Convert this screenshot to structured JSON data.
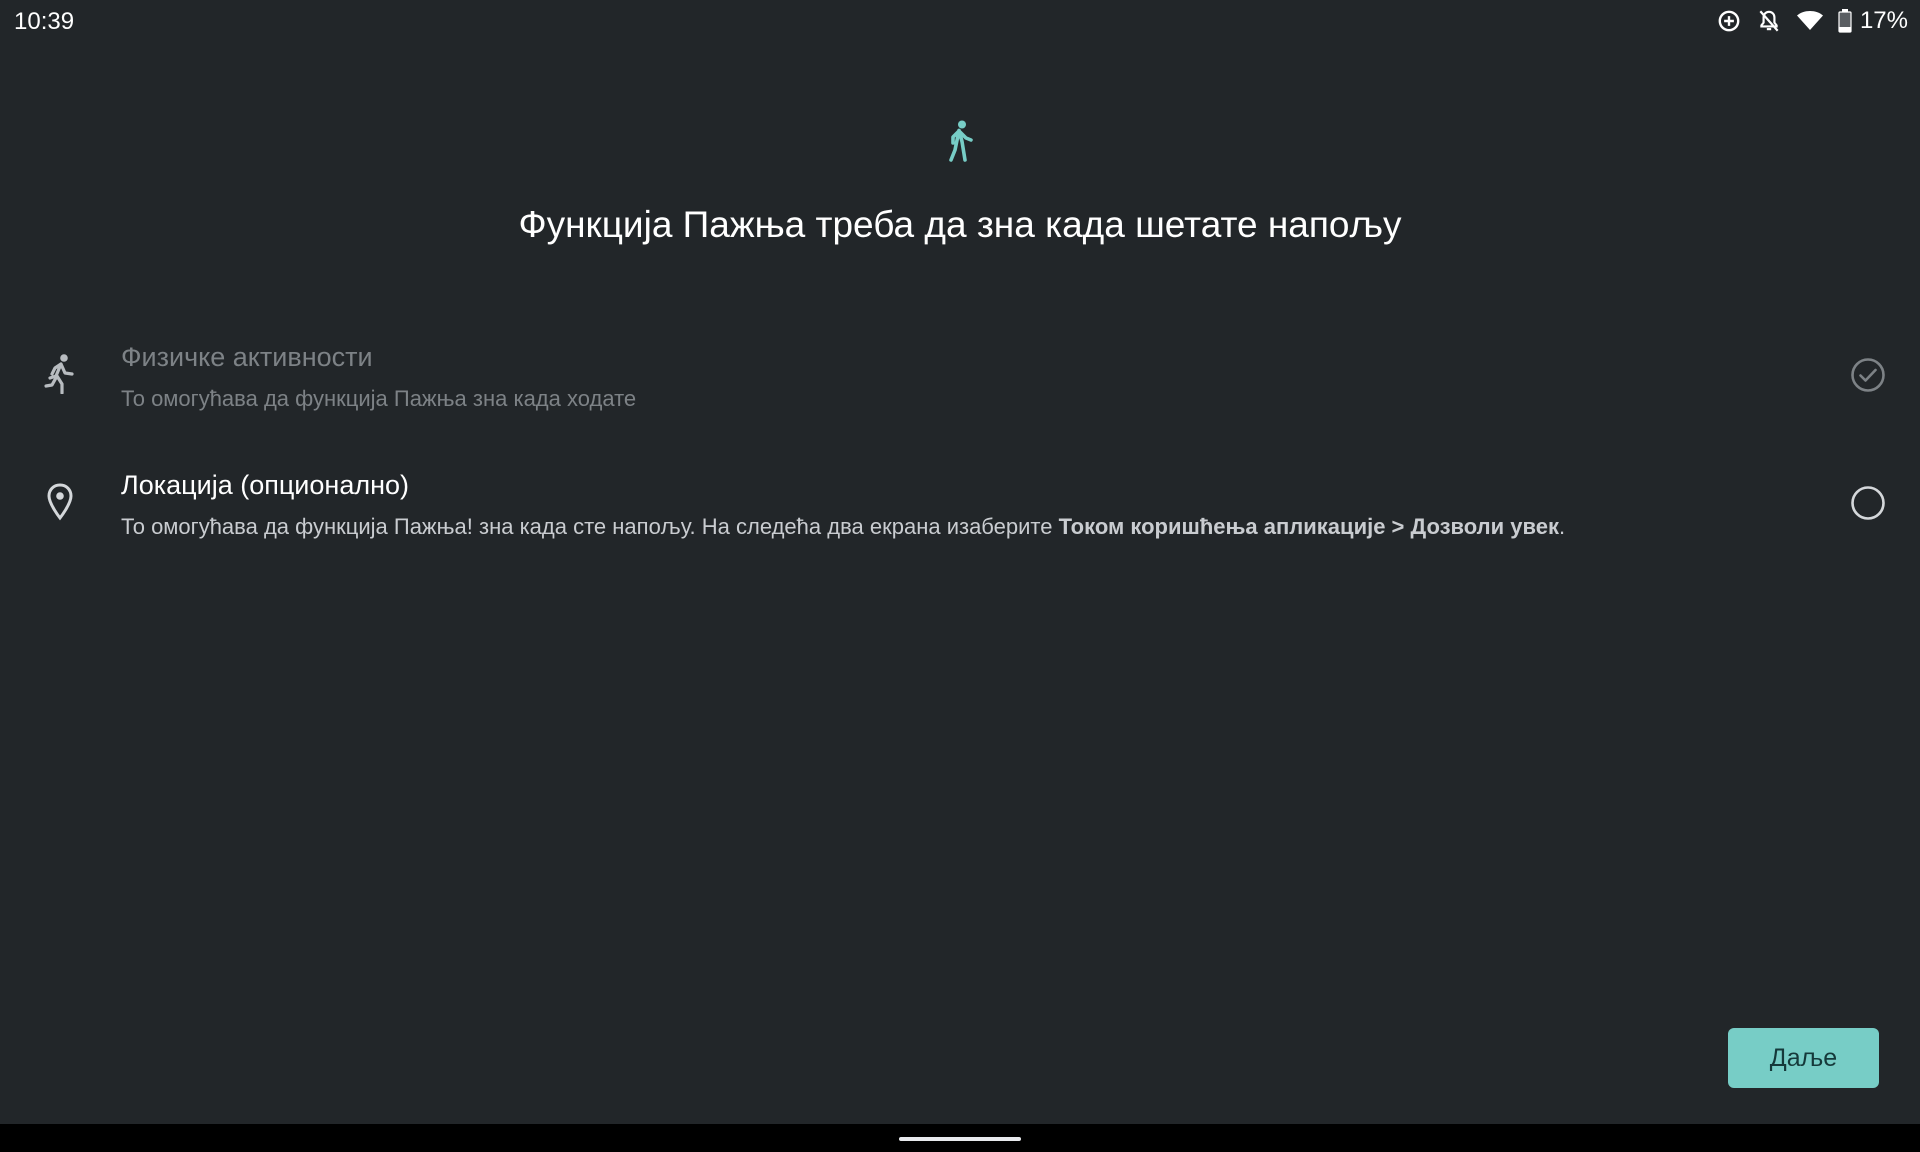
{
  "status_bar": {
    "time": "10:39",
    "battery_percent": "17%",
    "icons": [
      "data-saver-icon",
      "notifications-off-icon",
      "wifi-icon",
      "battery-icon"
    ]
  },
  "header": {
    "icon": "walking-person-icon",
    "title": "Функција Пажња треба да зна када шетате напољу"
  },
  "permissions": [
    {
      "icon": "running-person-icon",
      "title": "Физичке активности",
      "description": "То омогућава да функција Пажња зна када ходате",
      "granted": true,
      "status_icon": "check-circle-icon"
    },
    {
      "icon": "location-pin-icon",
      "title": "Локација (опционално)",
      "description_prefix": "То омогућава да функција Пажња! зна када сте напољу. На следећа два екрана изаберите ",
      "description_bold": "Током коришћења апликације > Дозволи увек",
      "description_suffix": ".",
      "granted": false,
      "status_icon": "empty-circle-icon"
    }
  ],
  "actions": {
    "next_label": "Даље"
  },
  "colors": {
    "background": "#222629",
    "accent": "#77cdc6",
    "button_text": "#15393a"
  }
}
